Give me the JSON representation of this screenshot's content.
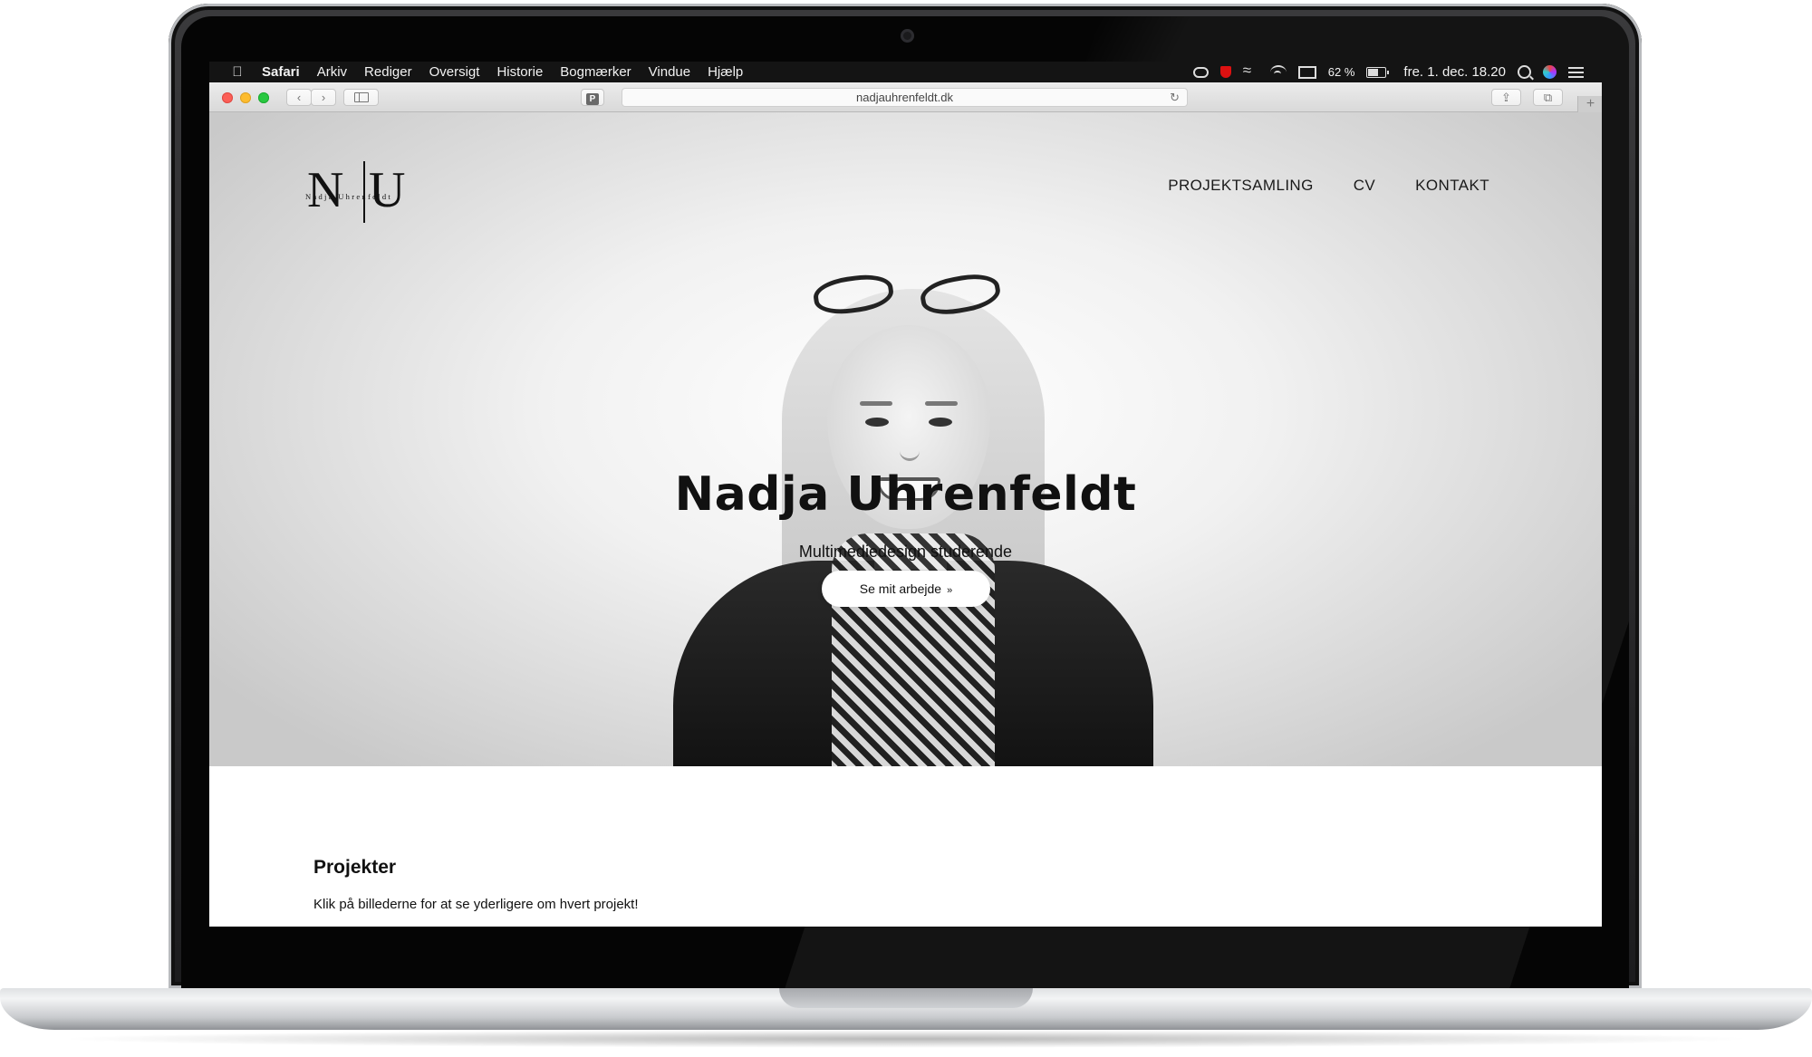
{
  "menubar": {
    "app_name": "Safari",
    "items": [
      "Arkiv",
      "Rediger",
      "Oversigt",
      "Historie",
      "Bogmærker",
      "Vindue",
      "Hjælp"
    ],
    "battery_text": "62 %",
    "battery_level": 0.62,
    "clock": "fre. 1. dec.  18.20",
    "status_icons": [
      "creative-cloud-icon",
      "shield-icon",
      "wave-icon",
      "wifi-icon",
      "airplay-icon",
      "battery-icon",
      "search-icon",
      "siri-icon",
      "notification-list-icon"
    ]
  },
  "toolbar": {
    "url": "nadjauhrenfeldt.dk",
    "back_glyph": "‹",
    "forward_glyph": "›",
    "pocket_glyph": "P",
    "reload_glyph": "↻",
    "share_glyph": "⇪",
    "tabs_glyph": "⧉",
    "newtab_glyph": "+"
  },
  "site": {
    "logo": {
      "letter_left": "N",
      "letter_right": "U",
      "subtitle": "Nadja Uhrenfeldt"
    },
    "nav": [
      "PROJEKTSAMLING",
      "CV",
      "KONTAKT"
    ],
    "hero": {
      "title": "Nadja Uhrenfeldt",
      "subtitle": "Multimediedesign studerende",
      "cta_label": "Se mit arbejde",
      "cta_icon": "»"
    },
    "section": {
      "title": "Projekter",
      "text": "Klik på billederne for at se yderligere om hvert projekt!"
    }
  },
  "colors": {
    "traffic_close": "#fc5f57",
    "traffic_minimize": "#fdbc2e",
    "traffic_maximize": "#28c840",
    "menubar_bg": "#141414"
  }
}
